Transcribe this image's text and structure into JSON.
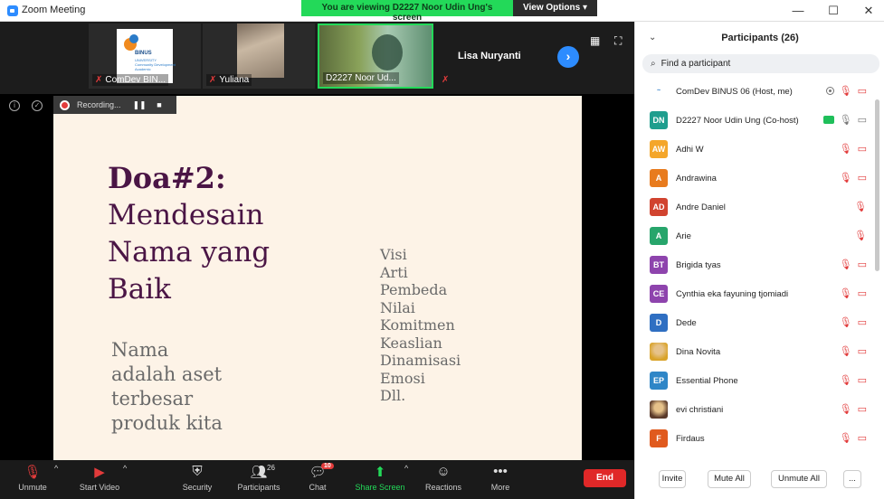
{
  "window": {
    "title": "Zoom Meeting",
    "viewing_banner": "You are viewing D2227 Noor Udin Ung's screen",
    "view_options": "View Options ▾",
    "controls": [
      "—",
      "☐",
      "✕"
    ]
  },
  "video_strip": {
    "tiles": [
      {
        "name": "ComDev BIN...",
        "muted": true
      },
      {
        "name": "Yuliana",
        "muted": true
      },
      {
        "name": "D2227 Noor Ud...",
        "muted": false
      },
      {
        "name": "Lisa Nuryanti",
        "muted": true
      }
    ],
    "logo_text": "BINUS",
    "logo_sub": "UNIVERSITY\nCommunity Development\nAcademic"
  },
  "recording": {
    "label": "Recording..."
  },
  "slide": {
    "title_bold": "Doa#2:",
    "title_lines": [
      "Mendesain",
      "Nama yang",
      "Baik"
    ],
    "left_lines": [
      "Nama",
      "adalah aset",
      "terbesar",
      "produk kita"
    ],
    "right_list": [
      "Visi",
      "Arti",
      "Pembeda",
      "Nilai",
      "Komitmen",
      "Keaslian",
      "Dinamisasi",
      "Emosi",
      "Dll."
    ]
  },
  "toolbar": {
    "unmute": "Unmute",
    "start_video": "Start Video",
    "security": "Security",
    "participants": "Participants",
    "participants_count": "26",
    "chat": "Chat",
    "chat_badge": "10",
    "share_screen": "Share Screen",
    "reactions": "Reactions",
    "more": "More",
    "end": "End"
  },
  "panel": {
    "title": "Participants (26)",
    "search_placeholder": "Find a participant",
    "participants": [
      {
        "initials": "",
        "name": "ComDev BINUS 06 (Host, me)",
        "color": "#ffffff",
        "icons": [
          "rec",
          "mic-off",
          "cam-off"
        ]
      },
      {
        "initials": "DN",
        "name": "D2227 Noor Udin Ung (Co-host)",
        "color": "#1f9e8e",
        "icons": [
          "share",
          "mic",
          "cam"
        ]
      },
      {
        "initials": "AW",
        "name": "Adhi W",
        "color": "#f4a62a",
        "icons": [
          "mic-off",
          "cam-off"
        ]
      },
      {
        "initials": "A",
        "name": "Andrawina",
        "color": "#e87b1e",
        "icons": [
          "mic-off",
          "cam-off"
        ]
      },
      {
        "initials": "AD",
        "name": "Andre Daniel",
        "color": "#d1432f",
        "icons": [
          "mic-off"
        ]
      },
      {
        "initials": "A",
        "name": "Arie",
        "color": "#27a56b",
        "icons": [
          "mic-off"
        ]
      },
      {
        "initials": "BT",
        "name": "Brigida tyas",
        "color": "#8e44ad",
        "icons": [
          "mic-off",
          "cam-off"
        ]
      },
      {
        "initials": "CE",
        "name": "Cynthia eka fayuning tjomiadi",
        "color": "#8e44ad",
        "icons": [
          "mic-off",
          "cam-off"
        ]
      },
      {
        "initials": "D",
        "name": "Dede",
        "color": "#2f6fc2",
        "icons": [
          "mic-off",
          "cam-off"
        ]
      },
      {
        "initials": "",
        "name": "Dina Novita",
        "color": "#d9a32a",
        "icons": [
          "mic-off",
          "cam-off"
        ]
      },
      {
        "initials": "EP",
        "name": "Essential Phone",
        "color": "#2f86c7",
        "icons": [
          "mic-off",
          "cam-off"
        ]
      },
      {
        "initials": "",
        "name": "evi christiani",
        "color": "#5a3a2a",
        "icons": [
          "mic-off",
          "cam-off"
        ]
      },
      {
        "initials": "F",
        "name": "Firdaus",
        "color": "#e05a1e",
        "icons": [
          "mic-off",
          "cam-off"
        ]
      }
    ],
    "invite": "Invite",
    "mute_all": "Mute All",
    "unmute_all": "Unmute All",
    "more": "..."
  }
}
